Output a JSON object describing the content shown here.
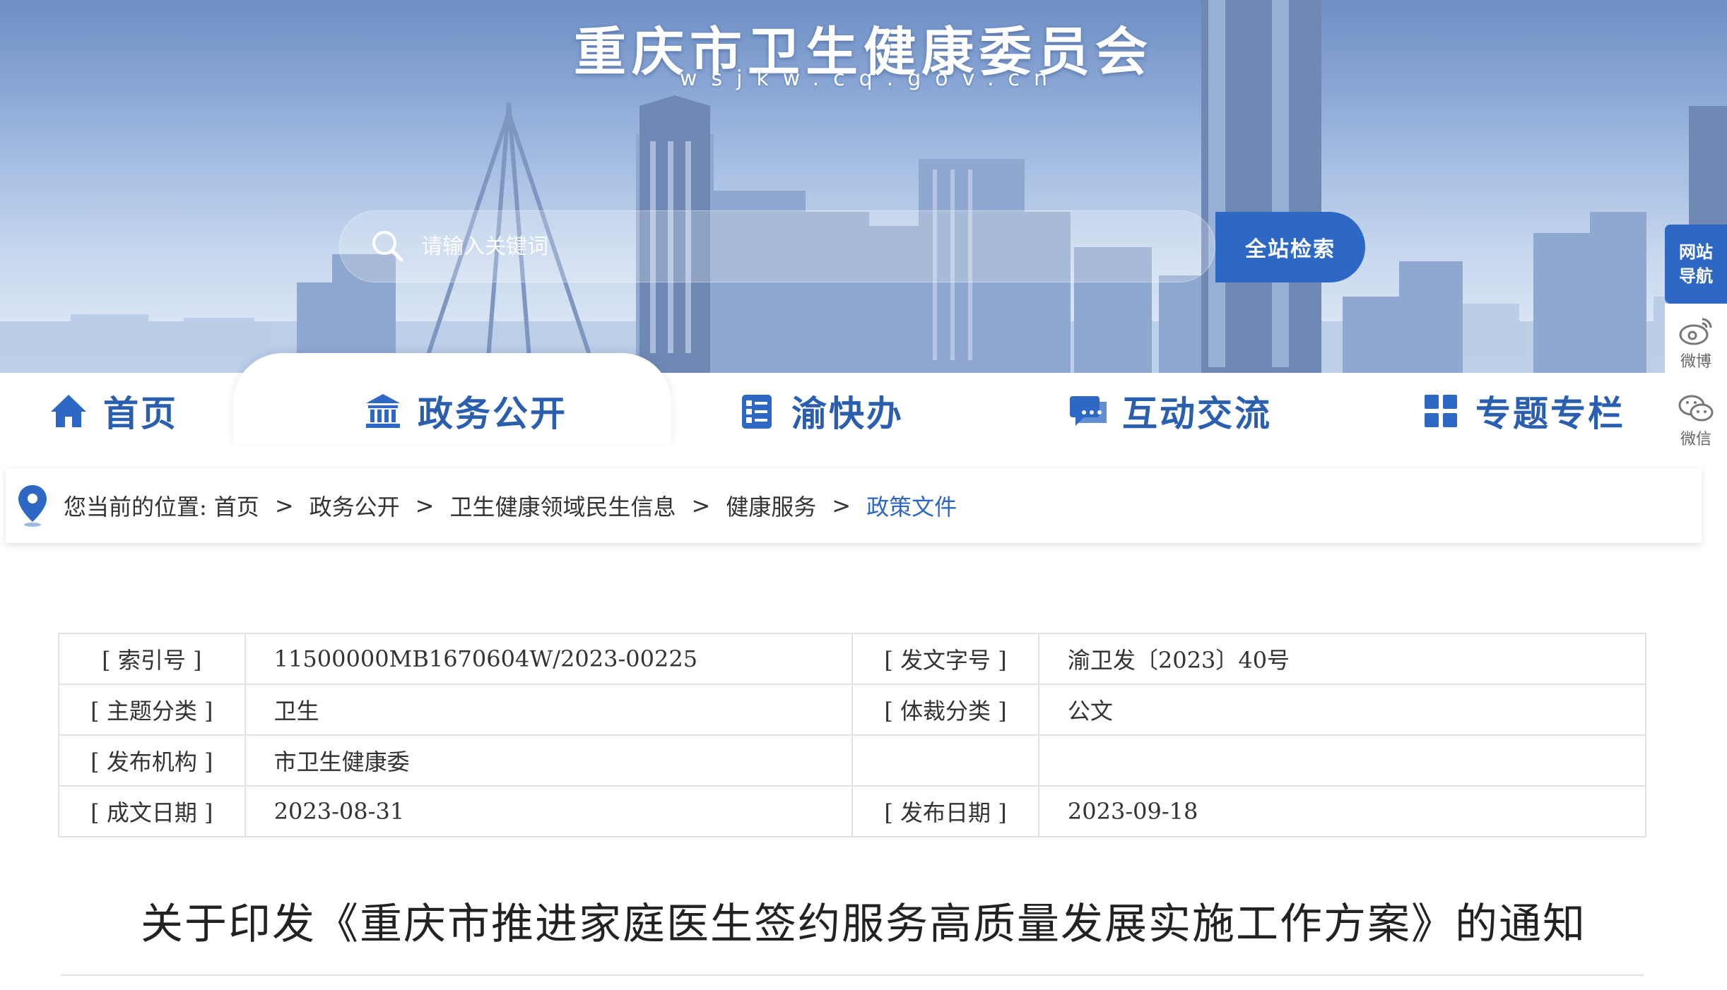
{
  "header": {
    "site_title": "重庆市卫生健康委员会",
    "site_domain": "wsjkw.cq.gov.cn",
    "search": {
      "placeholder": "请输入关键词",
      "button_label": "全站检索"
    }
  },
  "nav": {
    "active_tab": "政务公开",
    "tabs": [
      {
        "label": "首页",
        "icon": "home-icon"
      },
      {
        "label": "政务公开",
        "icon": "government-building-icon"
      },
      {
        "label": "渝快办",
        "icon": "checklist-icon"
      },
      {
        "label": "互动交流",
        "icon": "chat-bubble-icon"
      },
      {
        "label": "专题专栏",
        "icon": "grid-icon"
      }
    ]
  },
  "sidebar": {
    "site_nav": {
      "line1": "网站",
      "line2": "导航"
    },
    "weibo_label": "微博",
    "wechat_label": "微信"
  },
  "breadcrumb": {
    "prefix": "您当前的位置:",
    "items": [
      "首页",
      "政务公开",
      "卫生健康领域民生信息",
      "健康服务",
      "政策文件"
    ],
    "separator": ">"
  },
  "meta": {
    "rows": [
      [
        "[ 索引号 ]",
        "11500000MB1670604W/2023-00225",
        "[ 发文字号 ]",
        "渝卫发〔2023〕40号"
      ],
      [
        "[ 主题分类 ]",
        "卫生",
        "[ 体裁分类 ]",
        "公文"
      ],
      [
        "[ 发布机构 ]",
        "市卫生健康委",
        "",
        ""
      ],
      [
        "[ 成文日期 ]",
        "2023-08-31",
        "[ 发布日期 ]",
        "2023-09-18"
      ]
    ]
  },
  "document": {
    "title": "关于印发《重庆市推进家庭医生签约服务高质量发展实施工作方案》的通知"
  },
  "colors": {
    "accent": "#2d68c4",
    "nav_text": "#2a5fb0",
    "breadcrumb_current": "#2d68c4"
  }
}
